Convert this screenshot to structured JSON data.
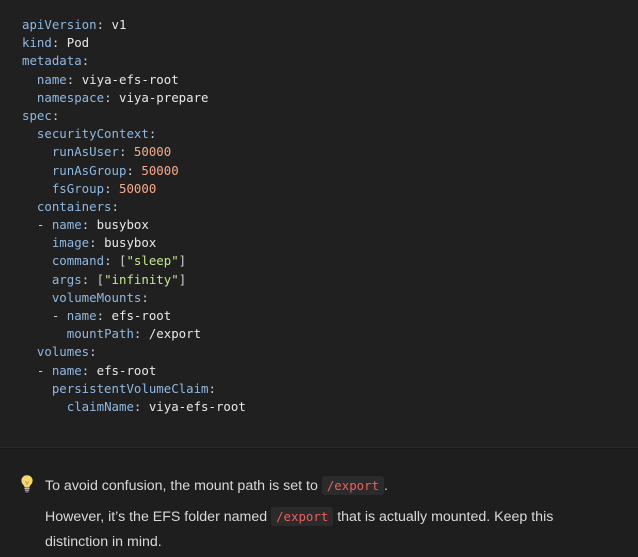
{
  "code": {
    "lines": [
      [
        [
          "k",
          "apiVersion"
        ],
        [
          "p",
          ": "
        ],
        [
          "v",
          "v1"
        ]
      ],
      [
        [
          "k",
          "kind"
        ],
        [
          "p",
          ": "
        ],
        [
          "v",
          "Pod"
        ]
      ],
      [
        [
          "k",
          "metadata"
        ],
        [
          "p",
          ":"
        ]
      ],
      [
        [
          "p",
          "  "
        ],
        [
          "k",
          "name"
        ],
        [
          "p",
          ": "
        ],
        [
          "v",
          "viya-efs-root"
        ]
      ],
      [
        [
          "p",
          "  "
        ],
        [
          "k",
          "namespace"
        ],
        [
          "p",
          ": "
        ],
        [
          "v",
          "viya-prepare"
        ]
      ],
      [
        [
          "k",
          "spec"
        ],
        [
          "p",
          ":"
        ]
      ],
      [
        [
          "p",
          "  "
        ],
        [
          "k",
          "securityContext"
        ],
        [
          "p",
          ":"
        ]
      ],
      [
        [
          "p",
          "    "
        ],
        [
          "k",
          "runAsUser"
        ],
        [
          "p",
          ": "
        ],
        [
          "n",
          "50000"
        ]
      ],
      [
        [
          "p",
          "    "
        ],
        [
          "k",
          "runAsGroup"
        ],
        [
          "p",
          ": "
        ],
        [
          "n",
          "50000"
        ]
      ],
      [
        [
          "p",
          "    "
        ],
        [
          "k",
          "fsGroup"
        ],
        [
          "p",
          ": "
        ],
        [
          "n",
          "50000"
        ]
      ],
      [
        [
          "p",
          "  "
        ],
        [
          "k",
          "containers"
        ],
        [
          "p",
          ":"
        ]
      ],
      [
        [
          "p",
          "  - "
        ],
        [
          "k",
          "name"
        ],
        [
          "p",
          ": "
        ],
        [
          "v",
          "busybox"
        ]
      ],
      [
        [
          "p",
          "    "
        ],
        [
          "k",
          "image"
        ],
        [
          "p",
          ": "
        ],
        [
          "v",
          "busybox"
        ]
      ],
      [
        [
          "p",
          "    "
        ],
        [
          "k",
          "command"
        ],
        [
          "p",
          ": "
        ],
        [
          "b",
          "["
        ],
        [
          "s",
          "\"sleep\""
        ],
        [
          "b",
          "]"
        ]
      ],
      [
        [
          "p",
          "    "
        ],
        [
          "k",
          "args"
        ],
        [
          "p",
          ": "
        ],
        [
          "b",
          "["
        ],
        [
          "s",
          "\"infinity\""
        ],
        [
          "b",
          "]"
        ]
      ],
      [
        [
          "p",
          "    "
        ],
        [
          "k",
          "volumeMounts"
        ],
        [
          "p",
          ":"
        ]
      ],
      [
        [
          "p",
          "    - "
        ],
        [
          "k",
          "name"
        ],
        [
          "p",
          ": "
        ],
        [
          "v",
          "efs-root"
        ]
      ],
      [
        [
          "p",
          "      "
        ],
        [
          "k",
          "mountPath"
        ],
        [
          "p",
          ": "
        ],
        [
          "v",
          "/export"
        ]
      ],
      [
        [
          "p",
          "  "
        ],
        [
          "k",
          "volumes"
        ],
        [
          "p",
          ":"
        ]
      ],
      [
        [
          "p",
          "  - "
        ],
        [
          "k",
          "name"
        ],
        [
          "p",
          ": "
        ],
        [
          "v",
          "efs-root"
        ]
      ],
      [
        [
          "p",
          "    "
        ],
        [
          "k",
          "persistentVolumeClaim"
        ],
        [
          "p",
          ":"
        ]
      ],
      [
        [
          "p",
          "      "
        ],
        [
          "k",
          "claimName"
        ],
        [
          "p",
          ": "
        ],
        [
          "v",
          "viya-efs-root"
        ]
      ]
    ]
  },
  "callout": {
    "icon": "lightbulb-icon",
    "line1_before": "To avoid confusion, the mount path is set to ",
    "line1_code": "/export",
    "line1_after": ".",
    "line2_before": "However, it’s the EFS folder named ",
    "line2_code": "/export",
    "line2_after": " that is actually mounted. Keep this distinction in mind."
  },
  "colors": {
    "yaml_key": "#8fb8e0",
    "yaml_number": "#f5a98a",
    "yaml_string": "#c3e88d",
    "inline_code": "#e9605a"
  }
}
